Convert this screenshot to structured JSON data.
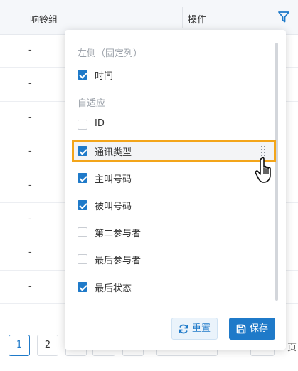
{
  "table": {
    "col_ring_group": "响铃组",
    "col_actions": "操作",
    "rows": [
      "-",
      "-",
      "-",
      "-",
      "-",
      "-",
      "-",
      "-"
    ]
  },
  "pagination": {
    "pages": [
      "1",
      "2"
    ],
    "current": "1",
    "trailing": "页"
  },
  "column_panel": {
    "group_fixed_label": "左侧（固定列）",
    "group_adaptive_label": "自适应",
    "fixed_items": [
      {
        "label": "时间",
        "checked": true
      }
    ],
    "adaptive_items": [
      {
        "label": "ID",
        "checked": false
      },
      {
        "label": "通讯类型",
        "checked": true
      },
      {
        "label": "主叫号码",
        "checked": true
      },
      {
        "label": "被叫号码",
        "checked": true
      },
      {
        "label": "第二参与者",
        "checked": false
      },
      {
        "label": "最后参与者",
        "checked": false
      },
      {
        "label": "最后状态",
        "checked": true
      }
    ],
    "reset_label": "重置",
    "save_label": "保存"
  },
  "colors": {
    "accent": "#1f7ac9",
    "highlight": "#f3a51a"
  },
  "icons": [
    "filter-icon",
    "drag-handle-icon",
    "hand-cursor-icon",
    "refresh-icon",
    "save-disk-icon"
  ]
}
